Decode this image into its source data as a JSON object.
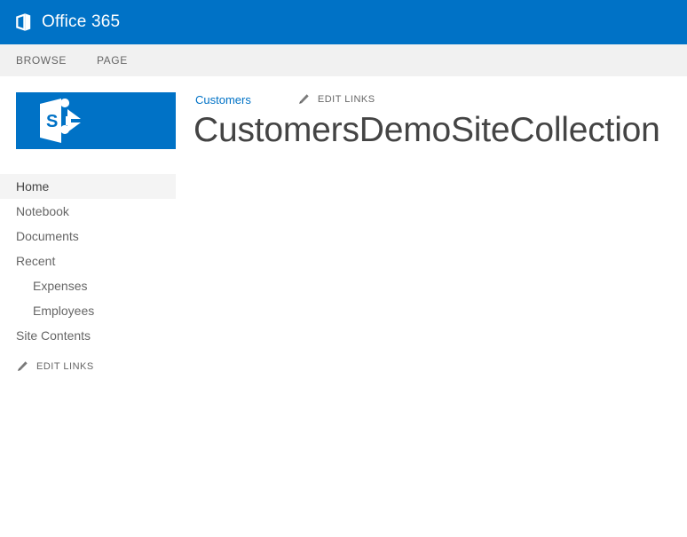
{
  "suite_bar": {
    "brand": "Office 365",
    "logo_icon": "office-logo-icon",
    "background": "#0072c6"
  },
  "ribbon": {
    "tabs": [
      {
        "label": "BROWSE"
      },
      {
        "label": "PAGE"
      }
    ]
  },
  "site_logo": {
    "icon": "sharepoint-logo-icon",
    "letter": "S",
    "background": "#0072c6"
  },
  "quick_launch": {
    "items": [
      {
        "label": "Home",
        "level": 0,
        "selected": true
      },
      {
        "label": "Notebook",
        "level": 0,
        "selected": false
      },
      {
        "label": "Documents",
        "level": 0,
        "selected": false
      },
      {
        "label": "Recent",
        "level": 0,
        "selected": false
      },
      {
        "label": "Expenses",
        "level": 1,
        "selected": false
      },
      {
        "label": "Employees",
        "level": 1,
        "selected": false
      },
      {
        "label": "Site Contents",
        "level": 0,
        "selected": false
      }
    ],
    "edit_links": {
      "label": "EDIT LINKS",
      "icon": "pencil-icon"
    }
  },
  "top_nav": {
    "links": [
      {
        "label": "Customers"
      }
    ],
    "edit_links": {
      "label": "EDIT LINKS",
      "icon": "pencil-icon"
    }
  },
  "main": {
    "title": "CustomersDemoSiteCollection"
  },
  "colors": {
    "accent": "#0072c6",
    "ribbon_background": "#f1f1f1",
    "selected_nav_background": "#f4f4f4",
    "text": "#444444",
    "muted_text": "#666666"
  }
}
